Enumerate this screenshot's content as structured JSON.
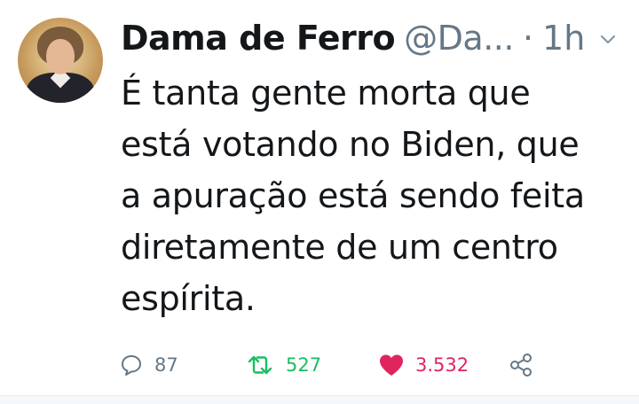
{
  "tweet": {
    "author_name": "Dama de Ferro",
    "handle": "@Da...",
    "separator": "·",
    "time": "1h",
    "text_lines": [
      "É tanta gente morta que",
      "está votando no Biden, que",
      "a apuração está sendo feita",
      "diretamente de um centro",
      "espírita."
    ]
  },
  "actions": {
    "replies": "87",
    "retweets": "527",
    "likes": "3.532"
  },
  "icons": {
    "reply": "speech-bubble-icon",
    "retweet": "retweet-arrows-icon",
    "like": "heart-icon",
    "share": "share-icon",
    "menu": "chevron-down-icon"
  },
  "colors": {
    "retweet": "#17bf63",
    "like": "#e0245e",
    "muted": "#657786",
    "text": "#14171a"
  }
}
